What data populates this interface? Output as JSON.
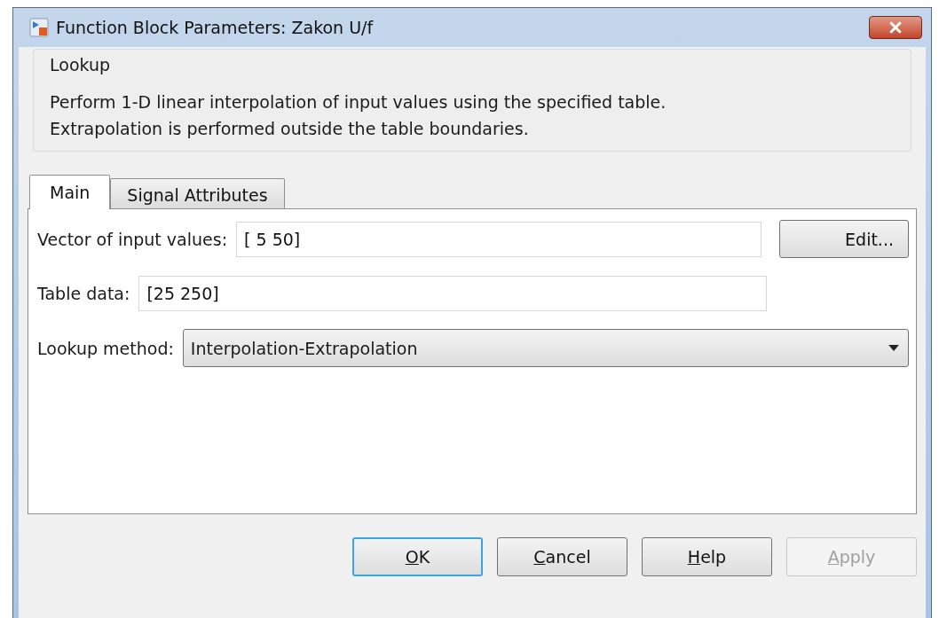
{
  "window": {
    "title": "Function Block Parameters: Zakon U/f"
  },
  "group": {
    "title": "Lookup",
    "description": [
      "Perform 1-D linear interpolation of input values using the specified table.",
      "Extrapolation is performed outside the table boundaries."
    ]
  },
  "tabs": [
    {
      "label": "Main",
      "selected": true
    },
    {
      "label": "Signal Attributes",
      "selected": false
    }
  ],
  "vector_of_input_values": {
    "label": "Vector of input values:",
    "value": "[ 5 50]",
    "edit_button": "Edit..."
  },
  "table_data": {
    "label": "Table data:",
    "value": "[25 250]"
  },
  "lookup_method": {
    "label": "Lookup method:",
    "value": "Interpolation-Extrapolation"
  },
  "buttons": [
    {
      "mnemonic": "O",
      "rest": "K",
      "default": true,
      "disabled": false
    },
    {
      "mnemonic": "C",
      "rest": "ancel",
      "default": false,
      "disabled": false
    },
    {
      "mnemonic": "H",
      "rest": "elp",
      "default": false,
      "disabled": false
    },
    {
      "mnemonic": "A",
      "rest": "pply",
      "default": false,
      "disabled": true
    }
  ]
}
